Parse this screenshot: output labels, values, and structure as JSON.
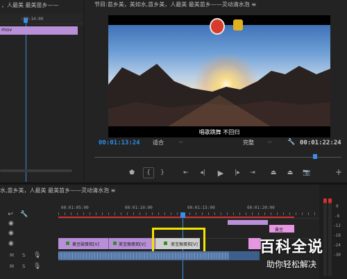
{
  "source_panel": {
    "title": "，人最美 最美苗乡——",
    "ruler_tick": ":00:14:00",
    "clip_label": "mov"
  },
  "program_panel": {
    "title": "节目:苗乡美，美如水,苗乡美，人最美 最美苗乡——灵动清水泡 ≡",
    "subtitle": "唱歌跳舞 不回归",
    "current_time": "00:01:13:24",
    "fit_label": "适合",
    "quality_label": "完整",
    "duration": "00:01:22:24"
  },
  "transport": {
    "icons": [
      "marker-icon",
      "mark-in-icon",
      "mark-out-icon",
      "go-to-in-icon",
      "step-back-icon",
      "play-icon",
      "step-forward-icon",
      "go-to-out-icon",
      "lift-icon",
      "extract-icon",
      "export-frame-icon",
      "add-button-icon"
    ]
  },
  "timeline": {
    "title": "水,苗乡美，人最美 最美苗乡——灵动清水泡 ≡",
    "ticks": [
      "00:01:05:00",
      "00:01:10:00",
      "00:01:15:00",
      "00:01:20:00"
    ],
    "track_controls": {
      "m": "M",
      "s": "S"
    },
    "clips": [
      {
        "name": "黄豆破蛋拓[V]"
      },
      {
        "name": "美宝猴蛋拓[V]"
      },
      {
        "name": "美宝猴蛋拓[V]"
      },
      {
        "name": "黄豆"
      }
    ],
    "meter_scale": [
      "0",
      "-6",
      "-12",
      "-18",
      "-24",
      "-30"
    ]
  },
  "watermark": {
    "line1": "百科全说",
    "line2": "助你轻松解决"
  },
  "colors": {
    "accent_blue": "#2d8ceb",
    "clip_purple": "#b98fd8",
    "audio_blue": "#4f6f9c",
    "highlight_yellow": "#f5e400",
    "playhead": "#3a8ee6",
    "workarea_red": "#d33030"
  }
}
